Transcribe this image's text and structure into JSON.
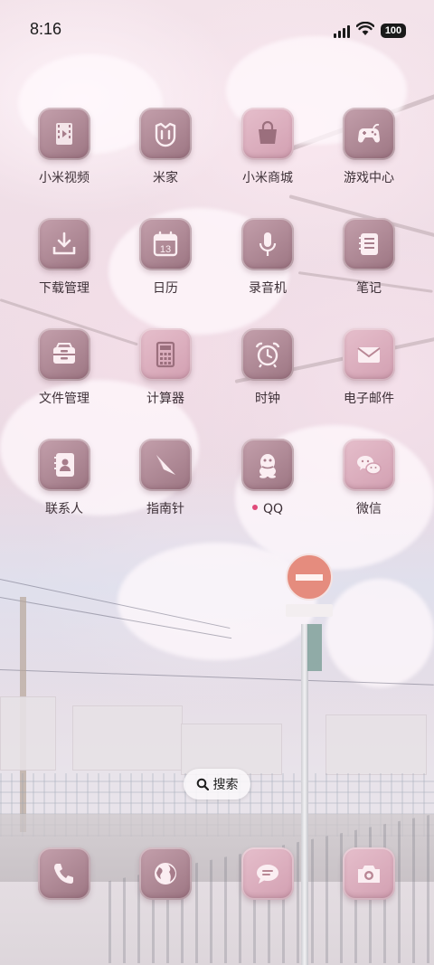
{
  "status_bar": {
    "time": "8:16",
    "battery": "100",
    "icons": [
      "signal-icon",
      "wifi-icon",
      "battery-icon"
    ]
  },
  "apps": [
    {
      "label": "小米视频",
      "icon": "video-film-icon"
    },
    {
      "label": "米家",
      "icon": "mijia-cat-icon"
    },
    {
      "label": "小米商城",
      "icon": "shopping-bag-icon"
    },
    {
      "label": "游戏中心",
      "icon": "gamepad-icon"
    },
    {
      "label": "下载管理",
      "icon": "download-tray-icon"
    },
    {
      "label": "日历",
      "icon": "calendar-icon",
      "day": "13"
    },
    {
      "label": "录音机",
      "icon": "microphone-icon"
    },
    {
      "label": "笔记",
      "icon": "notebook-icon"
    },
    {
      "label": "文件管理",
      "icon": "file-cabinet-icon"
    },
    {
      "label": "计算器",
      "icon": "calculator-icon"
    },
    {
      "label": "时钟",
      "icon": "alarm-clock-icon"
    },
    {
      "label": "电子邮件",
      "icon": "envelope-icon"
    },
    {
      "label": "联系人",
      "icon": "contacts-book-icon"
    },
    {
      "label": "指南针",
      "icon": "compass-icon"
    },
    {
      "label": "QQ",
      "icon": "qq-penguin-icon",
      "new_badge": true
    },
    {
      "label": "微信",
      "icon": "wechat-icon"
    }
  ],
  "search": {
    "label": "搜索",
    "icon": "search-icon"
  },
  "dock": [
    {
      "icon": "phone-icon"
    },
    {
      "icon": "browser-globe-icon"
    },
    {
      "icon": "messages-icon"
    },
    {
      "icon": "camera-icon"
    }
  ],
  "colors": {
    "icon_tile_dark": "#9c7582",
    "icon_tile_light": "#d29fb1",
    "badge": "#e04a7a",
    "label_text": "#3d3037"
  }
}
